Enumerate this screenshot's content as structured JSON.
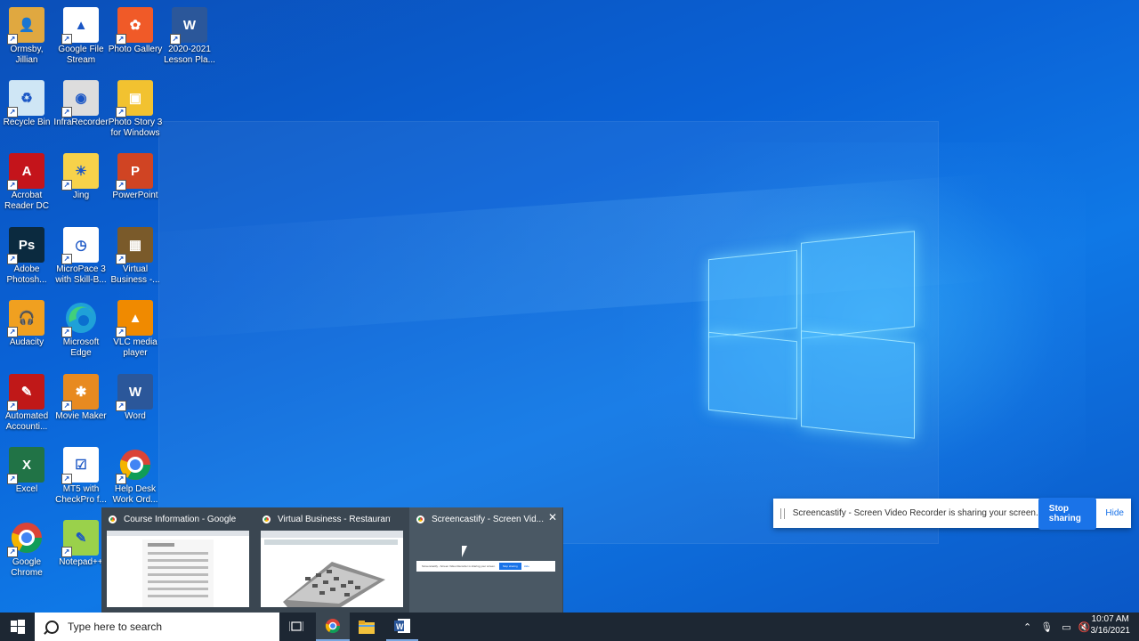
{
  "desktop_icons": [
    {
      "label": "Ormsby, Jillian",
      "icon": "user-folder-icon",
      "color": "#e0a840"
    },
    {
      "label": "Google File Stream",
      "icon": "google-drive-icon",
      "color": "#ffffff"
    },
    {
      "label": "Photo Gallery",
      "icon": "photo-gallery-icon",
      "color": "#f05a28"
    },
    {
      "label": "2020-2021 Lesson Pla...",
      "icon": "word-document-icon",
      "color": "#2b579a"
    },
    {
      "label": "Recycle Bin",
      "icon": "recycle-bin-icon",
      "color": "#cfe6f5"
    },
    {
      "label": "InfraRecorder",
      "icon": "infrarecorder-icon",
      "color": "#dddddd"
    },
    {
      "label": "Photo Story 3 for Windows",
      "icon": "photo-story-icon",
      "color": "#f2c230"
    },
    {
      "label": "Acrobat Reader DC",
      "icon": "acrobat-icon",
      "color": "#c4141b"
    },
    {
      "label": "Jing",
      "icon": "jing-icon",
      "color": "#f7d24a"
    },
    {
      "label": "PowerPoint",
      "icon": "powerpoint-icon",
      "color": "#d04423"
    },
    {
      "label": "Adobe Photosh...",
      "icon": "photoshop-icon",
      "color": "#0b2a3f"
    },
    {
      "label": "MicroPace 3 with Skill-B...",
      "icon": "clock-icon",
      "color": "#ffffff"
    },
    {
      "label": "Virtual Business -...",
      "icon": "virtual-business-icon",
      "color": "#7a5a2a"
    },
    {
      "label": "Audacity",
      "icon": "audacity-icon",
      "color": "#f0a020"
    },
    {
      "label": "Microsoft Edge",
      "icon": "edge-icon",
      "color": "#1fa1d8"
    },
    {
      "label": "VLC media player",
      "icon": "vlc-icon",
      "color": "#f08a00"
    },
    {
      "label": "Automated Accounti...",
      "icon": "automated-accounting-icon",
      "color": "#c01818"
    },
    {
      "label": "Movie Maker",
      "icon": "movie-maker-icon",
      "color": "#e88a20"
    },
    {
      "label": "Word",
      "icon": "word-icon",
      "color": "#2b579a"
    },
    {
      "label": "Excel",
      "icon": "excel-icon",
      "color": "#217346"
    },
    {
      "label": "MT5 with CheckPro f...",
      "icon": "mt5-icon",
      "color": "#ffffff"
    },
    {
      "label": "Help Desk Work Ord...",
      "icon": "chrome-icon",
      "color": "#4285f4"
    },
    {
      "label": "Google Chrome",
      "icon": "chrome-icon",
      "color": "#4285f4"
    },
    {
      "label": "Notepad++",
      "icon": "notepad-plus-plus-icon",
      "color": "#9ad14b"
    }
  ],
  "notification": {
    "text": "Screencastify - Screen Video Recorder is sharing your screen.",
    "stop_label": "Stop sharing",
    "hide_label": "Hide"
  },
  "previews": [
    {
      "title": "Course Information - Google C..."
    },
    {
      "title": "Virtual Business - Restaurant M..."
    },
    {
      "title": "Screencastify - Screen Vid...",
      "close": "✕"
    }
  ],
  "mini_bar": {
    "text": "Screencastify - Screen Video Recorder is sharing your screen.",
    "stop": "Stop sharing",
    "hide": "Hide"
  },
  "taskbar": {
    "search_placeholder": "Type here to search",
    "time": "10:07 AM",
    "date": "3/16/2021"
  }
}
